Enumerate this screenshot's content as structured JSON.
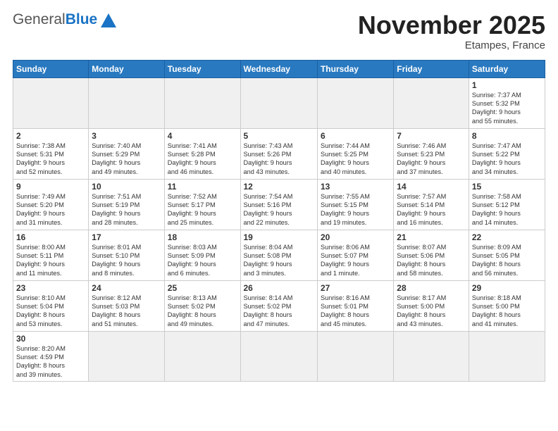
{
  "header": {
    "logo_general": "General",
    "logo_blue": "Blue",
    "month_year": "November 2025",
    "location": "Etampes, France"
  },
  "weekdays": [
    "Sunday",
    "Monday",
    "Tuesday",
    "Wednesday",
    "Thursday",
    "Friday",
    "Saturday"
  ],
  "weeks": [
    [
      {
        "day": "",
        "info": ""
      },
      {
        "day": "",
        "info": ""
      },
      {
        "day": "",
        "info": ""
      },
      {
        "day": "",
        "info": ""
      },
      {
        "day": "",
        "info": ""
      },
      {
        "day": "",
        "info": ""
      },
      {
        "day": "1",
        "info": "Sunrise: 7:37 AM\nSunset: 5:32 PM\nDaylight: 9 hours\nand 55 minutes."
      }
    ],
    [
      {
        "day": "2",
        "info": "Sunrise: 7:38 AM\nSunset: 5:31 PM\nDaylight: 9 hours\nand 52 minutes."
      },
      {
        "day": "3",
        "info": "Sunrise: 7:40 AM\nSunset: 5:29 PM\nDaylight: 9 hours\nand 49 minutes."
      },
      {
        "day": "4",
        "info": "Sunrise: 7:41 AM\nSunset: 5:28 PM\nDaylight: 9 hours\nand 46 minutes."
      },
      {
        "day": "5",
        "info": "Sunrise: 7:43 AM\nSunset: 5:26 PM\nDaylight: 9 hours\nand 43 minutes."
      },
      {
        "day": "6",
        "info": "Sunrise: 7:44 AM\nSunset: 5:25 PM\nDaylight: 9 hours\nand 40 minutes."
      },
      {
        "day": "7",
        "info": "Sunrise: 7:46 AM\nSunset: 5:23 PM\nDaylight: 9 hours\nand 37 minutes."
      },
      {
        "day": "8",
        "info": "Sunrise: 7:47 AM\nSunset: 5:22 PM\nDaylight: 9 hours\nand 34 minutes."
      }
    ],
    [
      {
        "day": "9",
        "info": "Sunrise: 7:49 AM\nSunset: 5:20 PM\nDaylight: 9 hours\nand 31 minutes."
      },
      {
        "day": "10",
        "info": "Sunrise: 7:51 AM\nSunset: 5:19 PM\nDaylight: 9 hours\nand 28 minutes."
      },
      {
        "day": "11",
        "info": "Sunrise: 7:52 AM\nSunset: 5:17 PM\nDaylight: 9 hours\nand 25 minutes."
      },
      {
        "day": "12",
        "info": "Sunrise: 7:54 AM\nSunset: 5:16 PM\nDaylight: 9 hours\nand 22 minutes."
      },
      {
        "day": "13",
        "info": "Sunrise: 7:55 AM\nSunset: 5:15 PM\nDaylight: 9 hours\nand 19 minutes."
      },
      {
        "day": "14",
        "info": "Sunrise: 7:57 AM\nSunset: 5:14 PM\nDaylight: 9 hours\nand 16 minutes."
      },
      {
        "day": "15",
        "info": "Sunrise: 7:58 AM\nSunset: 5:12 PM\nDaylight: 9 hours\nand 14 minutes."
      }
    ],
    [
      {
        "day": "16",
        "info": "Sunrise: 8:00 AM\nSunset: 5:11 PM\nDaylight: 9 hours\nand 11 minutes."
      },
      {
        "day": "17",
        "info": "Sunrise: 8:01 AM\nSunset: 5:10 PM\nDaylight: 9 hours\nand 8 minutes."
      },
      {
        "day": "18",
        "info": "Sunrise: 8:03 AM\nSunset: 5:09 PM\nDaylight: 9 hours\nand 6 minutes."
      },
      {
        "day": "19",
        "info": "Sunrise: 8:04 AM\nSunset: 5:08 PM\nDaylight: 9 hours\nand 3 minutes."
      },
      {
        "day": "20",
        "info": "Sunrise: 8:06 AM\nSunset: 5:07 PM\nDaylight: 9 hours\nand 1 minute."
      },
      {
        "day": "21",
        "info": "Sunrise: 8:07 AM\nSunset: 5:06 PM\nDaylight: 8 hours\nand 58 minutes."
      },
      {
        "day": "22",
        "info": "Sunrise: 8:09 AM\nSunset: 5:05 PM\nDaylight: 8 hours\nand 56 minutes."
      }
    ],
    [
      {
        "day": "23",
        "info": "Sunrise: 8:10 AM\nSunset: 5:04 PM\nDaylight: 8 hours\nand 53 minutes."
      },
      {
        "day": "24",
        "info": "Sunrise: 8:12 AM\nSunset: 5:03 PM\nDaylight: 8 hours\nand 51 minutes."
      },
      {
        "day": "25",
        "info": "Sunrise: 8:13 AM\nSunset: 5:02 PM\nDaylight: 8 hours\nand 49 minutes."
      },
      {
        "day": "26",
        "info": "Sunrise: 8:14 AM\nSunset: 5:02 PM\nDaylight: 8 hours\nand 47 minutes."
      },
      {
        "day": "27",
        "info": "Sunrise: 8:16 AM\nSunset: 5:01 PM\nDaylight: 8 hours\nand 45 minutes."
      },
      {
        "day": "28",
        "info": "Sunrise: 8:17 AM\nSunset: 5:00 PM\nDaylight: 8 hours\nand 43 minutes."
      },
      {
        "day": "29",
        "info": "Sunrise: 8:18 AM\nSunset: 5:00 PM\nDaylight: 8 hours\nand 41 minutes."
      }
    ],
    [
      {
        "day": "30",
        "info": "Sunrise: 8:20 AM\nSunset: 4:59 PM\nDaylight: 8 hours\nand 39 minutes."
      },
      {
        "day": "",
        "info": ""
      },
      {
        "day": "",
        "info": ""
      },
      {
        "day": "",
        "info": ""
      },
      {
        "day": "",
        "info": ""
      },
      {
        "day": "",
        "info": ""
      },
      {
        "day": "",
        "info": ""
      }
    ]
  ]
}
